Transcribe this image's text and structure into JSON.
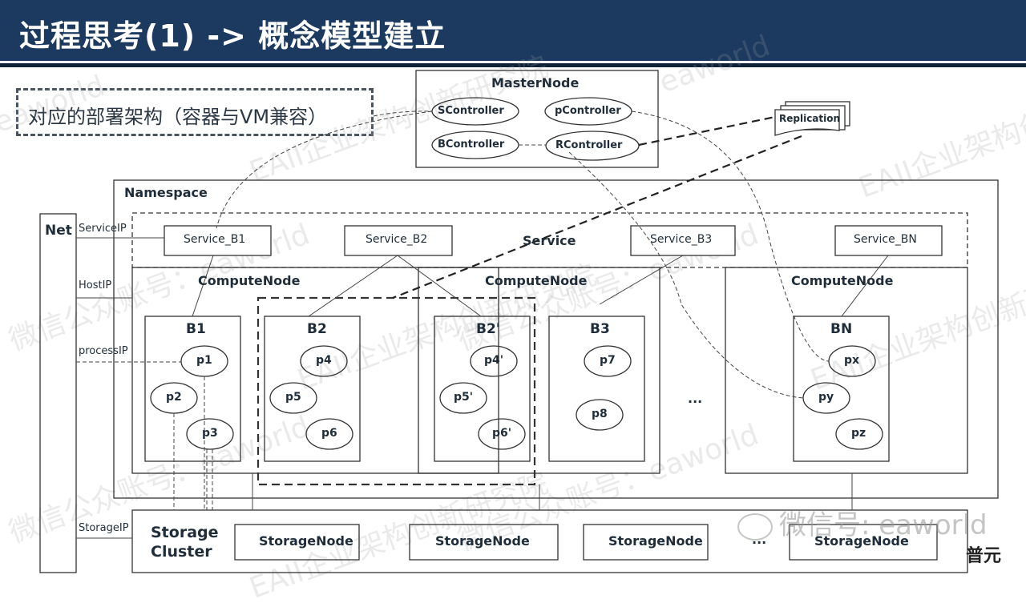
{
  "title": "过程思考(1) -> 概念模型建立",
  "subtitle": "对应的部署架构（容器与VM兼容）",
  "master_node": {
    "label": "MasterNode",
    "controllers": [
      "SController",
      "pController",
      "BController",
      "RController"
    ]
  },
  "replication": "Replication",
  "namespace": "Namespace",
  "net": {
    "label": "Net",
    "ips": [
      "ServiceIP",
      "HostIP",
      "processIP",
      "StorageIP"
    ]
  },
  "service_layer": {
    "label": "Service",
    "services": [
      "Service_B1",
      "Service_B2",
      "Service_B3",
      "Service_BN"
    ]
  },
  "compute_nodes": [
    {
      "label": "ComputeNode"
    },
    {
      "label": "ComputeNode"
    },
    {
      "label": "ComputeNode"
    }
  ],
  "pods": [
    {
      "name": "B1",
      "processes": [
        "p1",
        "p2",
        "p3"
      ]
    },
    {
      "name": "B2",
      "processes": [
        "p4",
        "p5",
        "p6"
      ]
    },
    {
      "name": "B2'",
      "processes": [
        "p4'",
        "p5'",
        "p6'"
      ]
    },
    {
      "name": "B3",
      "processes": [
        "p7",
        "p8"
      ]
    },
    {
      "name": "BN",
      "processes": [
        "px",
        "py",
        "pz"
      ]
    }
  ],
  "ellipsis": "...",
  "storage": {
    "cluster_label_line1": "Storage",
    "cluster_label_line2": "Cluster",
    "nodes": [
      "StorageNode",
      "StorageNode",
      "StorageNode",
      "StorageNode"
    ],
    "ellipsis": "..."
  },
  "watermark": {
    "wechat_text": "微信号: eaworld",
    "brand": "普元",
    "repeat_texts": [
      "eaworld",
      "EAII企业架构创新研究院",
      "微信公众账号：eaworld"
    ]
  },
  "colors": {
    "header_bg": "#1c3a60",
    "header_text": "#ffffff",
    "line": "#333333"
  }
}
